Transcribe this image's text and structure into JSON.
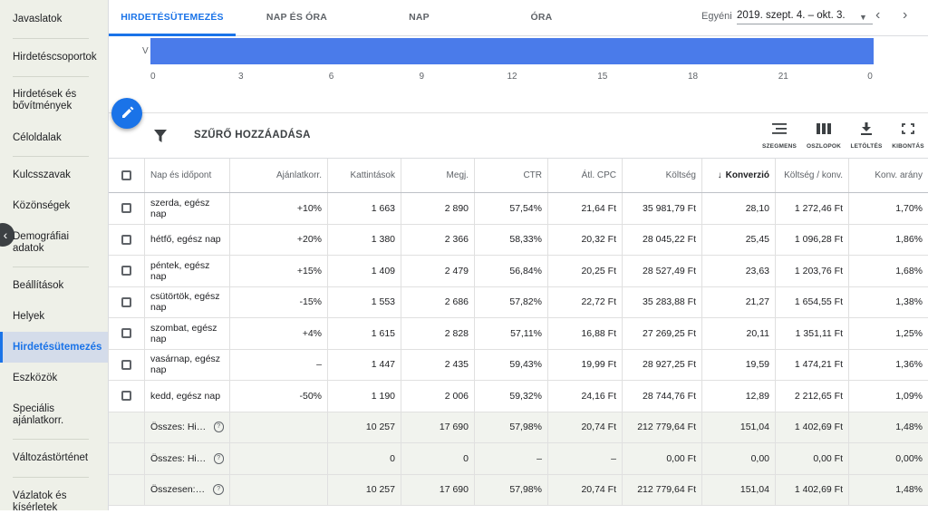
{
  "sidebar": {
    "items": [
      {
        "label": "Javaslatok"
      },
      {
        "label": "Hirdetéscsoportok"
      },
      {
        "label": "Hirdetések és bővítmények"
      },
      {
        "label": "Céloldalak"
      },
      {
        "label": "Kulcsszavak"
      },
      {
        "label": "Közönségek"
      },
      {
        "label": "Demográfiai adatok"
      },
      {
        "label": "Beállítások"
      },
      {
        "label": "Helyek"
      },
      {
        "label": "Hirdetésütemezés"
      },
      {
        "label": "Eszközök"
      },
      {
        "label": "Speciális ajánlatkorr."
      },
      {
        "label": "Változástörténet"
      },
      {
        "label": "Vázlatok és kísérletek"
      }
    ],
    "active_item": "Hirdetésütemezés",
    "collapse_icon": "chevron-left-icon"
  },
  "tabs": [
    {
      "label": "HIRDETÉSÜTEMEZÉS",
      "active": true
    },
    {
      "label": "NAP ÉS ÓRA",
      "active": false
    },
    {
      "label": "NAP",
      "active": false
    },
    {
      "label": "ÓRA",
      "active": false
    }
  ],
  "date_range": {
    "label": "Egyéni",
    "value": "2019. szept. 4. – okt. 3."
  },
  "chart_data": {
    "type": "bar",
    "orientation": "horizontal",
    "categories": [
      "V"
    ],
    "x_ticks": [
      "0",
      "3",
      "6",
      "9",
      "12",
      "15",
      "18",
      "21",
      "0"
    ],
    "series": [
      {
        "start_hour": 0,
        "end_hour": 24
      }
    ],
    "bar_color": "#4a7bea"
  },
  "toolbar": {
    "filter_label": "SZŰRŐ HOZZÁADÁSA",
    "tools": [
      {
        "label": "SZEGMENS",
        "icon": "segment-icon"
      },
      {
        "label": "OSZLOPOK",
        "icon": "columns-icon"
      },
      {
        "label": "LETÖLTÉS",
        "icon": "download-icon"
      },
      {
        "label": "KIBONTÁS",
        "icon": "expand-icon"
      }
    ]
  },
  "table": {
    "columns": [
      "Nap és időpont",
      "Ajánlatkorr.",
      "Kattintások",
      "Megj.",
      "CTR",
      "Átl. CPC",
      "Költség",
      "Konverzió",
      "Költség / konv.",
      "Konv. arány"
    ],
    "sorted_column": "Konverzió",
    "rows": [
      {
        "day": "szerda, egész nap",
        "bid": "+10%",
        "clicks": "1 663",
        "impr": "2 890",
        "ctr": "57,54%",
        "cpc": "21,64 Ft",
        "cost": "35 981,79 Ft",
        "conv": "28,10",
        "cost_conv": "1 272,46 Ft",
        "conv_rate": "1,70%"
      },
      {
        "day": "hétfő, egész nap",
        "bid": "+20%",
        "clicks": "1 380",
        "impr": "2 366",
        "ctr": "58,33%",
        "cpc": "20,32 Ft",
        "cost": "28 045,22 Ft",
        "conv": "25,45",
        "cost_conv": "1 096,28 Ft",
        "conv_rate": "1,86%"
      },
      {
        "day": "péntek, egész nap",
        "bid": "+15%",
        "clicks": "1 409",
        "impr": "2 479",
        "ctr": "56,84%",
        "cpc": "20,25 Ft",
        "cost": "28 527,49 Ft",
        "conv": "23,63",
        "cost_conv": "1 203,76 Ft",
        "conv_rate": "1,68%"
      },
      {
        "day": "csütörtök, egész nap",
        "bid": "-15%",
        "clicks": "1 553",
        "impr": "2 686",
        "ctr": "57,82%",
        "cpc": "22,72 Ft",
        "cost": "35 283,88 Ft",
        "conv": "21,27",
        "cost_conv": "1 654,55 Ft",
        "conv_rate": "1,38%"
      },
      {
        "day": "szombat, egész nap",
        "bid": "+4%",
        "clicks": "1 615",
        "impr": "2 828",
        "ctr": "57,11%",
        "cpc": "16,88 Ft",
        "cost": "27 269,25 Ft",
        "conv": "20,11",
        "cost_conv": "1 351,11 Ft",
        "conv_rate": "1,25%"
      },
      {
        "day": "vasárnap, egész nap",
        "bid": "–",
        "clicks": "1 447",
        "impr": "2 435",
        "ctr": "59,43%",
        "cpc": "19,99 Ft",
        "cost": "28 927,25 Ft",
        "conv": "19,59",
        "cost_conv": "1 474,21 Ft",
        "conv_rate": "1,36%"
      },
      {
        "day": "kedd, egész nap",
        "bid": "-50%",
        "clicks": "1 190",
        "impr": "2 006",
        "ctr": "59,32%",
        "cpc": "24,16 Ft",
        "cost": "28 744,76 Ft",
        "conv": "12,89",
        "cost_conv": "2 212,65 Ft",
        "conv_rate": "1,09%"
      }
    ],
    "totals": [
      {
        "label": "Összes: Hir…",
        "bid": "",
        "clicks": "10 257",
        "impr": "17 690",
        "ctr": "57,98%",
        "cpc": "20,74 Ft",
        "cost": "212 779,64 Ft",
        "conv": "151,04",
        "cost_conv": "1 402,69 Ft",
        "conv_rate": "1,48%"
      },
      {
        "label": "Összes: Hir…",
        "bid": "",
        "clicks": "0",
        "impr": "0",
        "ctr": "–",
        "cpc": "–",
        "cost": "0,00 Ft",
        "conv": "0,00",
        "cost_conv": "0,00 Ft",
        "conv_rate": "0,00%"
      },
      {
        "label": "Összesen: …",
        "bid": "",
        "clicks": "10 257",
        "impr": "17 690",
        "ctr": "57,98%",
        "cpc": "20,74 Ft",
        "cost": "212 779,64 Ft",
        "conv": "151,04",
        "cost_conv": "1 402,69 Ft",
        "conv_rate": "1,48%"
      }
    ]
  }
}
